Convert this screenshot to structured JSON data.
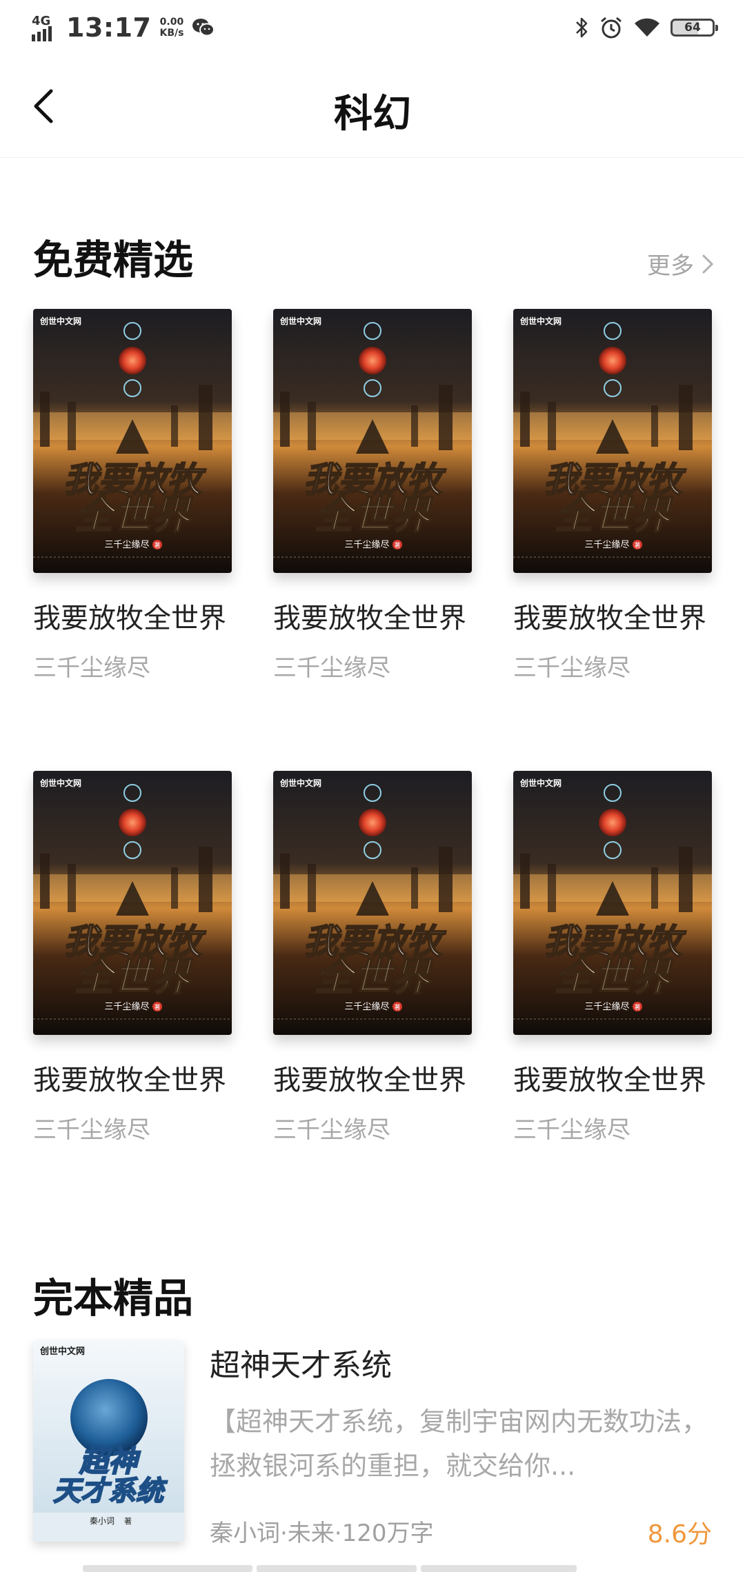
{
  "status_bar": {
    "network": "4G",
    "time": "13:17",
    "speed_value": "0.00",
    "speed_unit": "KB/s",
    "battery": "64"
  },
  "header": {
    "title": "科幻",
    "back_icon": "chevron-left-icon"
  },
  "free_section": {
    "title": "免费精选",
    "more_label": "更多",
    "books": [
      {
        "title": "我要放牧全世界",
        "author": "三千尘缘尽",
        "cover_title_line1": "我要放牧",
        "cover_title_line2": "全世界",
        "cover_author": "三千尘缘尽",
        "cover_badge": "著",
        "publisher": "创世中文网"
      },
      {
        "title": "我要放牧全世界",
        "author": "三千尘缘尽",
        "cover_title_line1": "我要放牧",
        "cover_title_line2": "全世界",
        "cover_author": "三千尘缘尽",
        "cover_badge": "著",
        "publisher": "创世中文网"
      },
      {
        "title": "我要放牧全世界",
        "author": "三千尘缘尽",
        "cover_title_line1": "我要放牧",
        "cover_title_line2": "全世界",
        "cover_author": "三千尘缘尽",
        "cover_badge": "著",
        "publisher": "创世中文网"
      },
      {
        "title": "我要放牧全世界",
        "author": "三千尘缘尽",
        "cover_title_line1": "我要放牧",
        "cover_title_line2": "全世界",
        "cover_author": "三千尘缘尽",
        "cover_badge": "著",
        "publisher": "创世中文网"
      },
      {
        "title": "我要放牧全世界",
        "author": "三千尘缘尽",
        "cover_title_line1": "我要放牧",
        "cover_title_line2": "全世界",
        "cover_author": "三千尘缘尽",
        "cover_badge": "著",
        "publisher": "创世中文网"
      },
      {
        "title": "我要放牧全世界",
        "author": "三千尘缘尽",
        "cover_title_line1": "我要放牧",
        "cover_title_line2": "全世界",
        "cover_author": "三千尘缘尽",
        "cover_badge": "著",
        "publisher": "创世中文网"
      }
    ]
  },
  "complete_section": {
    "title": "完本精品",
    "items": [
      {
        "title": "超神天才系统",
        "description": "【超神天才系统，复制宇宙网内无数功法，拯救银河系的重担，就交给你...",
        "meta": "秦小词·未来·120万字",
        "score": "8.6分",
        "cover_title_line1": "超神",
        "cover_title_line2": "天才系统",
        "cover_author": "秦小词",
        "cover_badge": "著",
        "publisher": "创世中文网"
      }
    ]
  },
  "colors": {
    "score": "#f0973b",
    "muted_text": "#a8a8a8",
    "title_text": "#111111"
  }
}
